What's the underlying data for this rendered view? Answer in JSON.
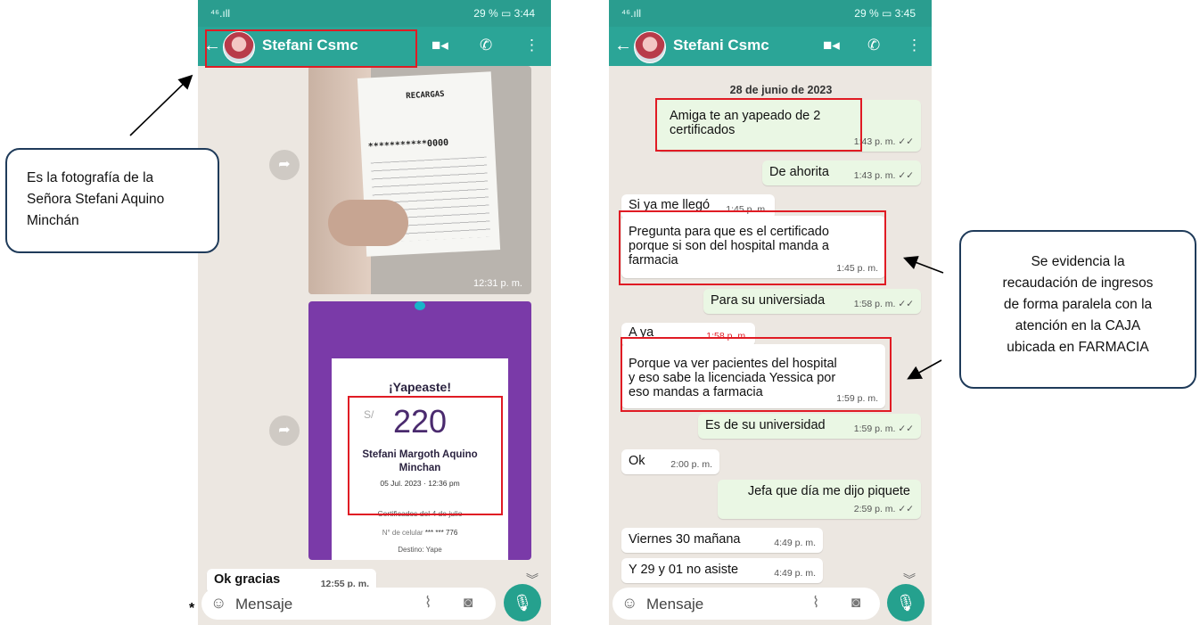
{
  "left_phone": {
    "status_signal": "⁴⁶.ıll",
    "status_battery": "29 %",
    "status_time": "3:44",
    "contact_name": "Stefani Csmc",
    "receipt": {
      "title": "RECARGAS",
      "masked_number": "***********0000",
      "time": "12:31 p. m."
    },
    "yape": {
      "heading": "¡Yapeaste!",
      "currency": "S/",
      "amount": "220",
      "recipient_line1": "Stefani Margoth Aquino",
      "recipient_line2": "Minchan",
      "datetime": "05 Jul. 2023 · 12:36 pm",
      "footer": "Certificados del 4 de julio",
      "phone_label": "N° de celular",
      "phone_value": "*** *** 776",
      "destino": "Destino: Yape"
    },
    "message": {
      "text": "Ok gracias",
      "time": "12:55 p. m."
    },
    "input_placeholder": "Mensaje",
    "asterisk": "*"
  },
  "right_phone": {
    "status_signal": "⁴⁶.ıll",
    "status_battery": "29 %",
    "status_time": "3:45",
    "contact_name": "Stefani Csmc",
    "date_chip": "28 de junio de 2023",
    "messages": [
      {
        "text1": "Amiga te an yapeado de 2",
        "text2": "certificados",
        "time": "1:43 p. m. ✓✓"
      },
      {
        "text1": "De ahorita",
        "time": "1:43 p. m. ✓✓"
      },
      {
        "text1": "Si ya me llegó",
        "time": "1:45 p. m."
      },
      {
        "text1": "Pregunta para que es el certificado",
        "text2": "porque si son del hospital manda a",
        "text3": "farmacia",
        "time": "1:45 p. m."
      },
      {
        "text1": "Para su universiada",
        "time": "1:58 p. m. ✓✓"
      },
      {
        "text1": "A ya",
        "time": "1:58 p. m."
      },
      {
        "text1": "Porque va ver pacientes del hospital",
        "text2": "y eso sabe la licenciada Yessica por",
        "text3": "eso mandas a farmacia",
        "time": "1:59 p. m."
      },
      {
        "text1": "Es de su universidad",
        "time": "1:59 p. m. ✓✓"
      },
      {
        "text1": "Ok",
        "time": "2:00 p. m."
      },
      {
        "text1": "Jefa que día me dijo piquete",
        "time": "2:59 p. m. ✓✓"
      },
      {
        "text1": "Viernes 30 mañana",
        "time": "4:49 p. m."
      },
      {
        "text1": "Y 29 y 01 no asiste",
        "time": "4:49 p. m."
      }
    ],
    "input_placeholder": "Mensaje"
  },
  "notes": {
    "left_lines": [
      "Es la fotografía de la",
      "Señora Stefani Aquino",
      "Minchán"
    ],
    "right_lines": [
      "Se evidencia la",
      "recaudación de ingresos",
      "de forma paralela con la",
      "atención en la CAJA",
      "ubicada en FARMACIA"
    ]
  },
  "icons": {
    "video": "video-icon",
    "call": "phone-icon",
    "menu": "more-vert-icon",
    "emoji": "emoji-icon",
    "attach": "paperclip-icon",
    "camera": "camera-icon",
    "mic": "mic-icon"
  },
  "colors": {
    "header": "#2ba597",
    "highlight": "#e01b24",
    "note_border": "#1f3b5a"
  }
}
